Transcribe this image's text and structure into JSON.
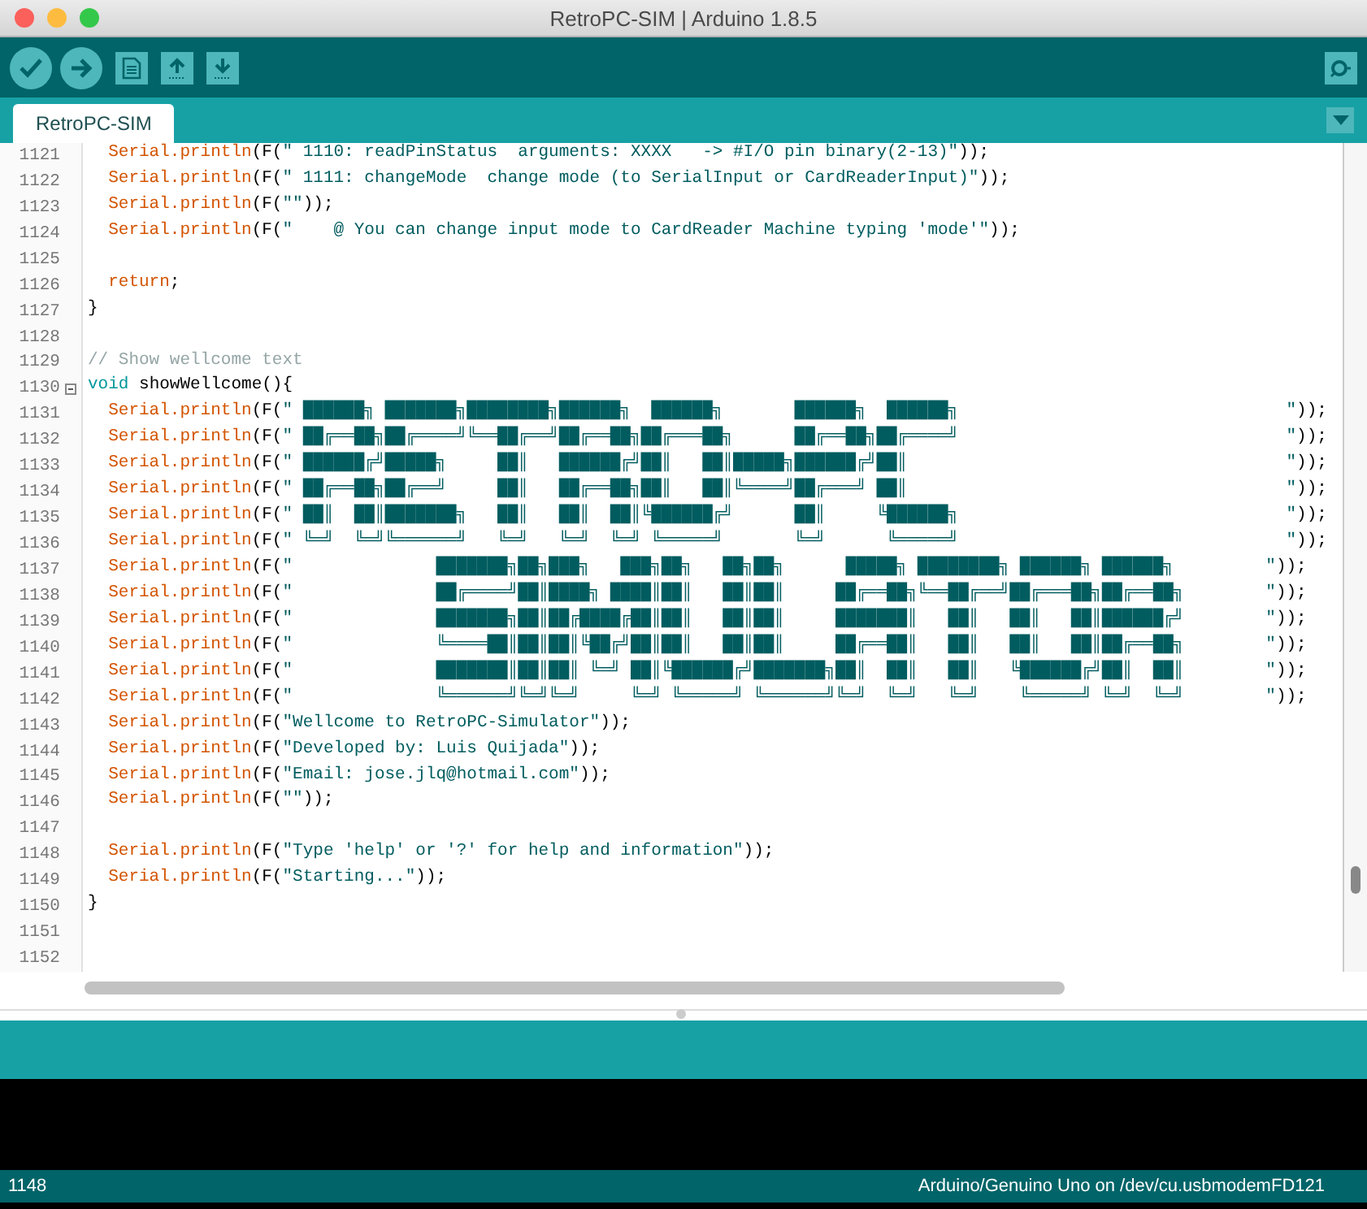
{
  "window": {
    "title": "RetroPC-SIM | Arduino 1.8.5"
  },
  "tabs": [
    {
      "label": "RetroPC-SIM",
      "selected": true
    }
  ],
  "editor": {
    "lines": [
      {
        "number": "1121",
        "foldable": false,
        "tokens": [
          {
            "kind": "call",
            "text": "  Serial.println"
          },
          {
            "kind": "plain",
            "text": "(F("
          },
          {
            "kind": "string",
            "text": "\" 1110: readPinStatus  arguments: XXXX   -> #I/O pin binary(2-13)\""
          },
          {
            "kind": "plain",
            "text": "));"
          }
        ]
      },
      {
        "number": "1122",
        "foldable": false,
        "tokens": [
          {
            "kind": "call",
            "text": "  Serial.println"
          },
          {
            "kind": "plain",
            "text": "(F("
          },
          {
            "kind": "string",
            "text": "\" 1111: changeMode  change mode (to SerialInput or CardReaderInput)\""
          },
          {
            "kind": "plain",
            "text": "));"
          }
        ]
      },
      {
        "number": "1123",
        "foldable": false,
        "tokens": [
          {
            "kind": "call",
            "text": "  Serial.println"
          },
          {
            "kind": "plain",
            "text": "(F("
          },
          {
            "kind": "string",
            "text": "\"\""
          },
          {
            "kind": "plain",
            "text": "));"
          }
        ]
      },
      {
        "number": "1124",
        "foldable": false,
        "tokens": [
          {
            "kind": "call",
            "text": "  Serial.println"
          },
          {
            "kind": "plain",
            "text": "(F("
          },
          {
            "kind": "string",
            "text": "\"    @ You can change input mode to CardReader Machine typing 'mode'\""
          },
          {
            "kind": "plain",
            "text": "));"
          }
        ]
      },
      {
        "number": "1125",
        "foldable": false
      },
      {
        "number": "1126",
        "foldable": false,
        "tokens": [
          {
            "kind": "control",
            "text": "  return"
          },
          {
            "kind": "plain",
            "text": ";"
          }
        ]
      },
      {
        "number": "1127",
        "foldable": false,
        "tokens": [
          {
            "kind": "plain",
            "text": "}"
          }
        ]
      },
      {
        "number": "1128",
        "foldable": false
      },
      {
        "number": "1129",
        "foldable": false,
        "tokens": [
          {
            "kind": "comment",
            "text": "// Show wellcome text"
          }
        ]
      },
      {
        "number": "1130",
        "foldable": true,
        "tokens": [
          {
            "kind": "type",
            "text": "void"
          },
          {
            "kind": "plain",
            "text": " showWellcome(){"
          }
        ]
      },
      {
        "number": "1131",
        "foldable": false,
        "tokens": [
          {
            "kind": "call",
            "text": "  Serial.println"
          },
          {
            "kind": "plain",
            "text": "(F("
          },
          {
            "kind": "string",
            "text": "\" ██████╗ ███████╗████████╗██████╗  ██████╗       ██████╗  ██████╗                                \""
          },
          {
            "kind": "plain",
            "text": "));"
          }
        ]
      },
      {
        "number": "1132",
        "foldable": false,
        "tokens": [
          {
            "kind": "call",
            "text": "  Serial.println"
          },
          {
            "kind": "plain",
            "text": "(F("
          },
          {
            "kind": "string",
            "text": "\" ██╔══██╗██╔════╝╚══██╔══╝██╔══██╗██╔═══██╗      ██╔══██╗██╔════╝                                \""
          },
          {
            "kind": "plain",
            "text": "));"
          }
        ]
      },
      {
        "number": "1133",
        "foldable": false,
        "tokens": [
          {
            "kind": "call",
            "text": "  Serial.println"
          },
          {
            "kind": "plain",
            "text": "(F("
          },
          {
            "kind": "string",
            "text": "\" ██████╔╝█████╗     ██║   ██████╔╝██║   ██║█████╗██████╔╝██║                                     \""
          },
          {
            "kind": "plain",
            "text": "));"
          }
        ]
      },
      {
        "number": "1134",
        "foldable": false,
        "tokens": [
          {
            "kind": "call",
            "text": "  Serial.println"
          },
          {
            "kind": "plain",
            "text": "(F("
          },
          {
            "kind": "string",
            "text": "\" ██╔══██╗██╔══╝     ██║   ██╔══██╗██║   ██║╚════╝██╔═══╝ ██║                                     \""
          },
          {
            "kind": "plain",
            "text": "));"
          }
        ]
      },
      {
        "number": "1135",
        "foldable": false,
        "tokens": [
          {
            "kind": "call",
            "text": "  Serial.println"
          },
          {
            "kind": "plain",
            "text": "(F("
          },
          {
            "kind": "string",
            "text": "\" ██║  ██║███████╗   ██║   ██║  ██║╚██████╔╝      ██║     ╚██████╗                                \""
          },
          {
            "kind": "plain",
            "text": "));"
          }
        ]
      },
      {
        "number": "1136",
        "foldable": false,
        "tokens": [
          {
            "kind": "call",
            "text": "  Serial.println"
          },
          {
            "kind": "plain",
            "text": "(F("
          },
          {
            "kind": "string",
            "text": "\" ╚═╝  ╚═╝╚══════╝   ╚═╝   ╚═╝  ╚═╝ ╚═════╝       ╚═╝      ╚═════╝                                \""
          },
          {
            "kind": "plain",
            "text": "));"
          }
        ]
      },
      {
        "number": "1137",
        "foldable": false,
        "tokens": [
          {
            "kind": "call",
            "text": "  Serial.println"
          },
          {
            "kind": "plain",
            "text": "(F("
          },
          {
            "kind": "string",
            "text": "\"              ███████╗██╗███╗   ███╗██╗   ██╗██╗      █████╗ ████████╗ ██████╗ ██████╗         \""
          },
          {
            "kind": "plain",
            "text": "));"
          }
        ]
      },
      {
        "number": "1138",
        "foldable": false,
        "tokens": [
          {
            "kind": "call",
            "text": "  Serial.println"
          },
          {
            "kind": "plain",
            "text": "(F("
          },
          {
            "kind": "string",
            "text": "\"              ██╔════╝██║████╗ ████║██║   ██║██║     ██╔══██╗╚══██╔══╝██╔═══██╗██╔══██╗        \""
          },
          {
            "kind": "plain",
            "text": "));"
          }
        ]
      },
      {
        "number": "1139",
        "foldable": false,
        "tokens": [
          {
            "kind": "call",
            "text": "  Serial.println"
          },
          {
            "kind": "plain",
            "text": "(F("
          },
          {
            "kind": "string",
            "text": "\"              ███████╗██║██╔████╔██║██║   ██║██║     ███████║   ██║   ██║   ██║██████╔╝        \""
          },
          {
            "kind": "plain",
            "text": "));"
          }
        ]
      },
      {
        "number": "1140",
        "foldable": false,
        "tokens": [
          {
            "kind": "call",
            "text": "  Serial.println"
          },
          {
            "kind": "plain",
            "text": "(F("
          },
          {
            "kind": "string",
            "text": "\"              ╚════██║██║██║╚██╔╝██║██║   ██║██║     ██╔══██║   ██║   ██║   ██║██╔══██╗        \""
          },
          {
            "kind": "plain",
            "text": "));"
          }
        ]
      },
      {
        "number": "1141",
        "foldable": false,
        "tokens": [
          {
            "kind": "call",
            "text": "  Serial.println"
          },
          {
            "kind": "plain",
            "text": "(F("
          },
          {
            "kind": "string",
            "text": "\"              ███████║██║██║ ╚═╝ ██║╚██████╔╝███████╗██║  ██║   ██║   ╚██████╔╝██║  ██║        \""
          },
          {
            "kind": "plain",
            "text": "));"
          }
        ]
      },
      {
        "number": "1142",
        "foldable": false,
        "tokens": [
          {
            "kind": "call",
            "text": "  Serial.println"
          },
          {
            "kind": "plain",
            "text": "(F("
          },
          {
            "kind": "string",
            "text": "\"              ╚══════╝╚═╝╚═╝     ╚═╝ ╚═════╝ ╚══════╝╚═╝  ╚═╝   ╚═╝    ╚═════╝ ╚═╝  ╚═╝        \""
          },
          {
            "kind": "plain",
            "text": "));"
          }
        ]
      },
      {
        "number": "1143",
        "foldable": false,
        "tokens": [
          {
            "kind": "call",
            "text": "  Serial.println"
          },
          {
            "kind": "plain",
            "text": "(F("
          },
          {
            "kind": "string",
            "text": "\"Wellcome to RetroPC-Simulator\""
          },
          {
            "kind": "plain",
            "text": "));"
          }
        ]
      },
      {
        "number": "1144",
        "foldable": false,
        "tokens": [
          {
            "kind": "call",
            "text": "  Serial.println"
          },
          {
            "kind": "plain",
            "text": "(F("
          },
          {
            "kind": "string",
            "text": "\"Developed by: Luis Quijada\""
          },
          {
            "kind": "plain",
            "text": "));"
          }
        ]
      },
      {
        "number": "1145",
        "foldable": false,
        "tokens": [
          {
            "kind": "call",
            "text": "  Serial.println"
          },
          {
            "kind": "plain",
            "text": "(F("
          },
          {
            "kind": "string",
            "text": "\"Email: jose.jlq@hotmail.com\""
          },
          {
            "kind": "plain",
            "text": "));"
          }
        ]
      },
      {
        "number": "1146",
        "foldable": false,
        "tokens": [
          {
            "kind": "call",
            "text": "  Serial.println"
          },
          {
            "kind": "plain",
            "text": "(F("
          },
          {
            "kind": "string",
            "text": "\"\""
          },
          {
            "kind": "plain",
            "text": "));"
          }
        ]
      },
      {
        "number": "1147",
        "foldable": false
      },
      {
        "number": "1148",
        "foldable": false,
        "tokens": [
          {
            "kind": "call",
            "text": "  Serial.println"
          },
          {
            "kind": "plain",
            "text": "(F("
          },
          {
            "kind": "string",
            "text": "\"Type 'help' or '?' for help and information\""
          },
          {
            "kind": "plain",
            "text": "));"
          }
        ]
      },
      {
        "number": "1149",
        "foldable": false,
        "tokens": [
          {
            "kind": "call",
            "text": "  Serial.println"
          },
          {
            "kind": "plain",
            "text": "(F("
          },
          {
            "kind": "string",
            "text": "\"Starting...\""
          },
          {
            "kind": "plain",
            "text": "));"
          }
        ]
      },
      {
        "number": "1150",
        "foldable": false,
        "tokens": [
          {
            "kind": "plain",
            "text": "}"
          }
        ]
      },
      {
        "number": "1151",
        "foldable": false
      },
      {
        "number": "1152",
        "foldable": false
      }
    ]
  },
  "status_bar": {
    "line": "1148",
    "board": "Arduino/Genuino Uno on /dev/cu.usbmodemFD121"
  }
}
